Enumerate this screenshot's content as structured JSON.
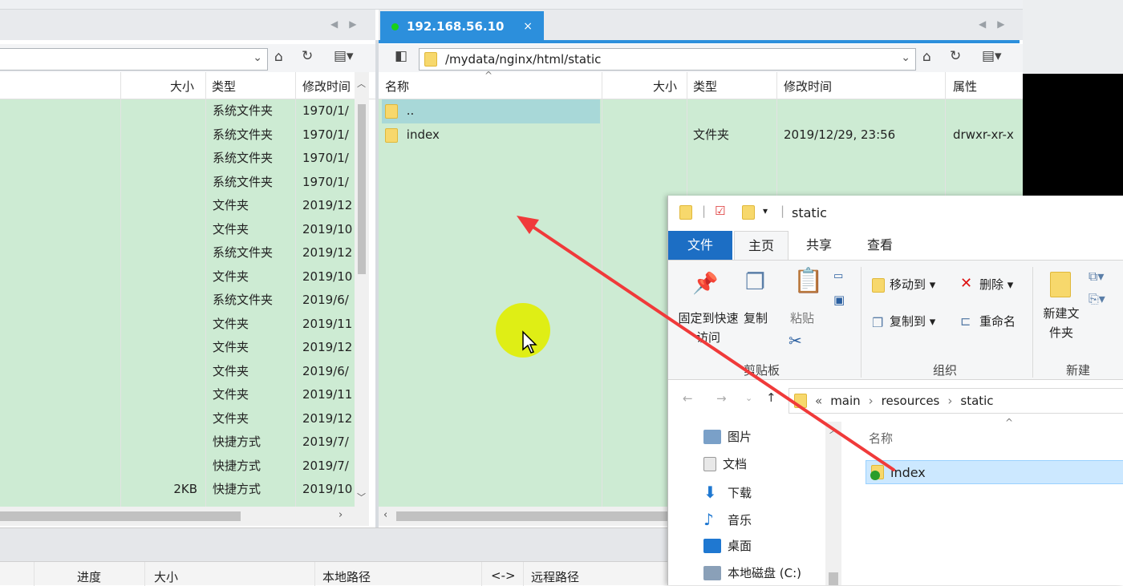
{
  "left_panel": {
    "headers": {
      "size": "大小",
      "type": "类型",
      "modified": "修改时间"
    },
    "rows": [
      {
        "size": "",
        "type": "系统文件夹",
        "modified": "1970/1/"
      },
      {
        "size": "",
        "type": "系统文件夹",
        "modified": "1970/1/"
      },
      {
        "size": "",
        "type": "系统文件夹",
        "modified": "1970/1/"
      },
      {
        "size": "",
        "type": "系统文件夹",
        "modified": "1970/1/"
      },
      {
        "size": "",
        "type": "文件夹",
        "modified": "2019/12"
      },
      {
        "size": "",
        "type": "文件夹",
        "modified": "2019/10"
      },
      {
        "size": "",
        "type": "系统文件夹",
        "modified": "2019/12"
      },
      {
        "size": "",
        "type": "文件夹",
        "modified": "2019/10"
      },
      {
        "size": "",
        "type": "系统文件夹",
        "modified": "2019/6/"
      },
      {
        "size": "",
        "type": "文件夹",
        "modified": "2019/11"
      },
      {
        "size": "",
        "type": "文件夹",
        "modified": "2019/12"
      },
      {
        "size": "",
        "type": "文件夹",
        "modified": "2019/6/"
      },
      {
        "size": "",
        "type": "文件夹",
        "modified": "2019/11"
      },
      {
        "size": "",
        "type": "文件夹",
        "modified": "2019/12"
      },
      {
        "size": "",
        "type": "快捷方式",
        "modified": "2019/7/"
      },
      {
        "size": "",
        "type": "快捷方式",
        "modified": "2019/7/"
      },
      {
        "size": "2KB",
        "type": "快捷方式",
        "modified": "2019/10"
      }
    ]
  },
  "right_panel": {
    "tab_label": "192.168.56.10",
    "tab_close": "×",
    "path": "/mydata/nginx/html/static",
    "headers": {
      "name": "名称",
      "size": "大小",
      "type": "类型",
      "modified": "修改时间",
      "attrs": "属性"
    },
    "rows": [
      {
        "name": "..",
        "size": "",
        "type": "",
        "modified": "",
        "attrs": ""
      },
      {
        "name": "index",
        "size": "",
        "type": "文件夹",
        "modified": "2019/12/29, 23:56",
        "attrs": "drwxr-xr-x"
      }
    ]
  },
  "transfer_bar": {
    "progress": "进度",
    "size": "大小",
    "local_path": "本地路径",
    "arrow": "<->",
    "remote_path": "远程路径"
  },
  "explorer": {
    "title": "static",
    "tabs": {
      "file": "文件",
      "home": "主页",
      "share": "共享",
      "view": "查看"
    },
    "ribbon": {
      "pin": "固定到快速访问",
      "copy": "复制",
      "paste": "粘贴",
      "clipboard_group": "剪贴板",
      "move_to": "移动到",
      "delete": "删除",
      "copy_to": "复制到",
      "rename": "重命名",
      "organize_group": "组织",
      "new_folder": "新建文件夹",
      "new_group": "新建"
    },
    "address": {
      "prefix": "«",
      "crumbs": [
        "main",
        "resources",
        "static"
      ],
      "sep": "›"
    },
    "nav_items": [
      "图片",
      "文档",
      "下载",
      "音乐",
      "桌面",
      "本地磁盘 (C:)"
    ],
    "column_name": "名称",
    "files": [
      "index"
    ]
  },
  "colors": {
    "tab_blue": "#2c8fdc",
    "green_bg": "#cdebd3",
    "arrow_red": "#f03a3a",
    "cursor_highlight": "#e1ee00"
  }
}
